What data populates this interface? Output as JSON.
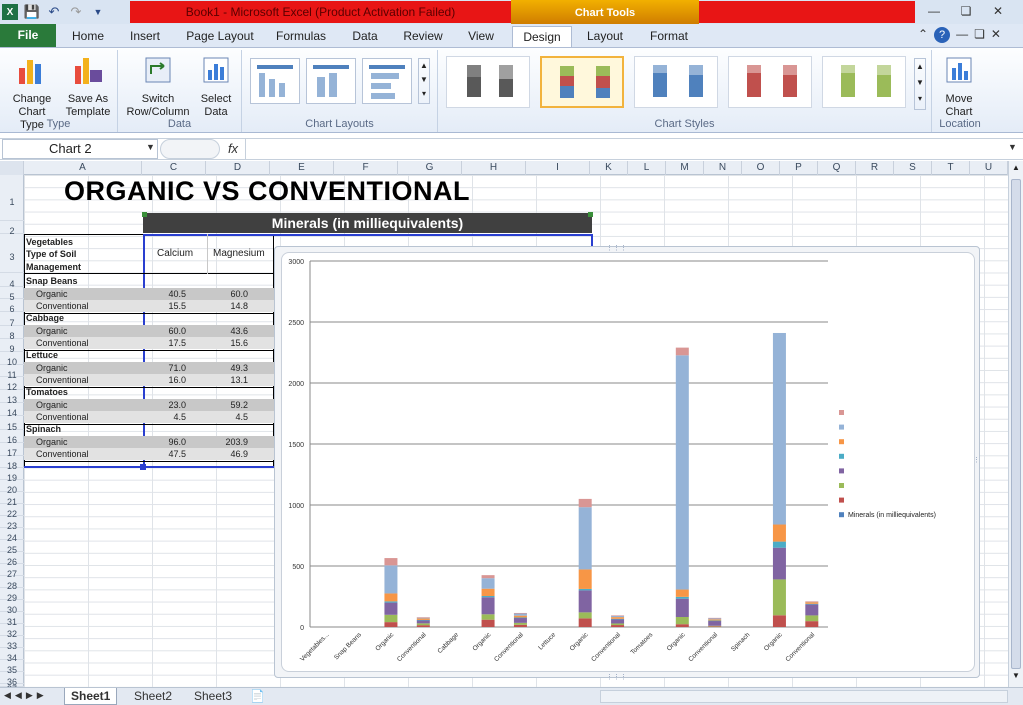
{
  "window": {
    "title": "Book1 - Microsoft Excel (Product Activation Failed)",
    "context_tab_group": "Chart Tools"
  },
  "tabs": {
    "file": "File",
    "items": [
      "Home",
      "Insert",
      "Page Layout",
      "Formulas",
      "Data",
      "Review",
      "View",
      "Design",
      "Layout",
      "Format"
    ],
    "active": "Design"
  },
  "ribbon": {
    "type_group": {
      "label": "Type",
      "change_chart_type": "Change\nChart Type",
      "save_as_template": "Save As\nTemplate"
    },
    "data_group": {
      "label": "Data",
      "switch_row_column": "Switch\nRow/Column",
      "select_data": "Select\nData"
    },
    "layouts_group": {
      "label": "Chart Layouts"
    },
    "styles_group": {
      "label": "Chart Styles"
    },
    "location_group": {
      "label": "Location",
      "move_chart": "Move\nChart"
    }
  },
  "formula_bar": {
    "name_box": "Chart 2",
    "fx": "fx",
    "formula": ""
  },
  "columns": [
    "A",
    "C",
    "D",
    "E",
    "F",
    "G",
    "H",
    "I",
    "K",
    "L",
    "M",
    "N",
    "O",
    "P",
    "Q",
    "R",
    "S",
    "T",
    "U"
  ],
  "rows": [
    "1",
    "2",
    "3",
    "4",
    "5",
    "6",
    "7",
    "8",
    "9",
    "10",
    "11",
    "12",
    "13",
    "14",
    "15",
    "16",
    "17",
    "18",
    "19",
    "20",
    "21",
    "22",
    "23",
    "24",
    "25",
    "26",
    "27",
    "28",
    "29",
    "30",
    "31",
    "32",
    "33",
    "34",
    "35",
    "36",
    "37"
  ],
  "sheet": {
    "title": "ORGANIC VS CONVENTIONAL",
    "minerals_header": "Minerals (in milliequivalents)",
    "veg_header_1": "Vegetables",
    "veg_header_2": "Type of Soil",
    "veg_header_3": "Management",
    "col_calcium": "Calcium",
    "col_magnesium": "Magnesium",
    "groups": [
      {
        "name": "Snap Beans",
        "organic": [
          "40.5",
          "60.0"
        ],
        "conventional": [
          "15.5",
          "14.8"
        ]
      },
      {
        "name": "Cabbage",
        "organic": [
          "60.0",
          "43.6"
        ],
        "conventional": [
          "17.5",
          "15.6"
        ]
      },
      {
        "name": "Lettuce",
        "organic": [
          "71.0",
          "49.3"
        ],
        "conventional": [
          "16.0",
          "13.1"
        ]
      },
      {
        "name": "Tomatoes",
        "organic": [
          "23.0",
          "59.2"
        ],
        "conventional": [
          "4.5",
          "4.5"
        ]
      },
      {
        "name": "Spinach",
        "organic": [
          "96.0",
          "203.9"
        ],
        "conventional": [
          "47.5",
          "46.9"
        ]
      }
    ],
    "organic_label": "Organic",
    "conventional_label": "Conventional"
  },
  "chart_data": {
    "type": "bar",
    "stacked": true,
    "title": "",
    "categories": [
      "Vegetables...",
      "Snap Beans",
      "Organic",
      "Conventional",
      "Cabbage",
      "Organic",
      "Conventional",
      "Lettuce",
      "Organic",
      "Conventional",
      "Tomatoes",
      "Organic",
      "Conventional",
      "Spinach",
      "Organic",
      "Conventional"
    ],
    "totals": [
      0,
      0,
      565,
      80,
      0,
      425,
      115,
      0,
      1050,
      95,
      0,
      2290,
      75,
      0,
      2410,
      210
    ],
    "segments": [
      {
        "color": "#c0504d",
        "values": [
          0,
          0,
          40,
          15,
          0,
          60,
          18,
          0,
          71,
          16,
          0,
          23,
          5,
          0,
          96,
          48
        ]
      },
      {
        "color": "#9bbb59",
        "values": [
          0,
          0,
          60,
          15,
          0,
          44,
          16,
          0,
          49,
          13,
          0,
          59,
          5,
          0,
          294,
          47
        ]
      },
      {
        "color": "#8064a2",
        "values": [
          0,
          0,
          100,
          25,
          0,
          140,
          40,
          0,
          180,
          35,
          0,
          150,
          40,
          0,
          260,
          90
        ]
      },
      {
        "color": "#4bacc6",
        "values": [
          0,
          0,
          10,
          3,
          0,
          10,
          4,
          0,
          12,
          3,
          0,
          15,
          3,
          0,
          50,
          5
        ]
      },
      {
        "color": "#f79646",
        "values": [
          0,
          0,
          65,
          12,
          0,
          60,
          15,
          0,
          160,
          14,
          0,
          60,
          10,
          0,
          140,
          14
        ]
      },
      {
        "color": "#95b3d7",
        "values": [
          0,
          0,
          230,
          7,
          0,
          86,
          18,
          0,
          510,
          10,
          0,
          1920,
          10,
          0,
          1570,
          4
        ]
      },
      {
        "color": "#d99694",
        "values": [
          0,
          0,
          60,
          3,
          0,
          25,
          4,
          0,
          68,
          4,
          0,
          63,
          2,
          0,
          0,
          2
        ]
      }
    ],
    "legend": [
      "",
      "",
      "",
      "",
      "",
      "",
      "",
      "Minerals (in milliequivalents)"
    ],
    "legend_colors": [
      "#d99694",
      "#95b3d7",
      "#f79646",
      "#4bacc6",
      "#8064a2",
      "#9bbb59",
      "#c0504d",
      "#4f81bd"
    ],
    "ylim": [
      0,
      3000
    ],
    "yticks": [
      "0",
      "500",
      "1000",
      "1500",
      "2000",
      "2500",
      "3000"
    ],
    "grid": true,
    "legend_position": "right"
  },
  "sheet_tabs": [
    "Sheet1",
    "Sheet2",
    "Sheet3"
  ]
}
